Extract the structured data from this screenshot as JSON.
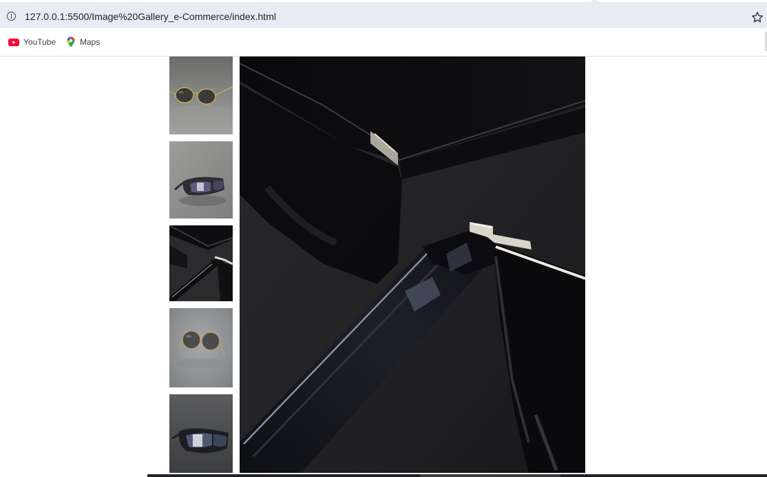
{
  "browser": {
    "url": "127.0.0.1:5500/Image%20Gallery_e-Commerce/index.html",
    "site_info_icon": "info-icon",
    "bookmark_star_icon": "star-icon",
    "bookmarks": [
      {
        "label": "YouTube",
        "icon": "youtube-icon"
      },
      {
        "label": "Maps",
        "icon": "maps-icon"
      }
    ]
  },
  "gallery": {
    "thumbnails": [
      {
        "subject": "gold-frame aviator sunglasses on grey fabric"
      },
      {
        "subject": "wrap sunglasses on grey fabric"
      },
      {
        "subject": "black sunglasses temple close-up"
      },
      {
        "subject": "round gold-frame sunglasses on grey"
      },
      {
        "subject": "sport sunglasses on dark fabric"
      }
    ],
    "selected_index": 2,
    "main_image_subject": "close-up of black square sunglasses with silver hinge"
  }
}
